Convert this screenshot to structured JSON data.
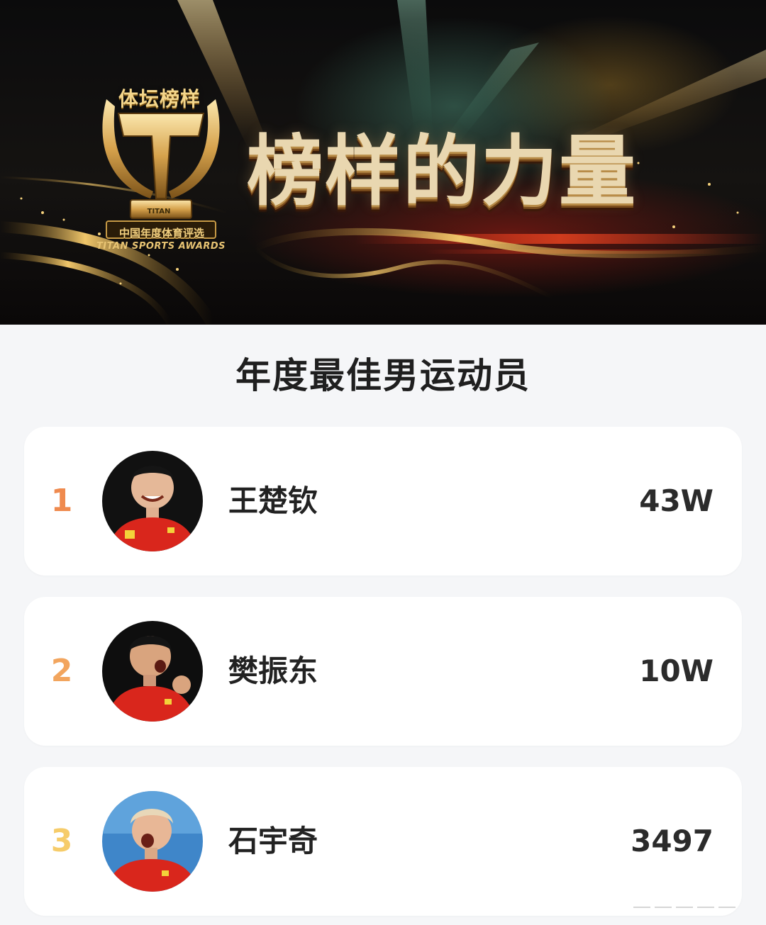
{
  "banner": {
    "logo_top_text": "体坛榜样",
    "logo_brand": "TITAN",
    "logo_cn": "中国年度体育评选",
    "logo_en": "TITAN SPORTS AWARDS",
    "headline": "榜样的力量"
  },
  "section": {
    "title": "年度最佳男运动员"
  },
  "ranking": [
    {
      "rank": "1",
      "name": "王楚钦",
      "votes": "43W",
      "rank_color": "#ef8a4e"
    },
    {
      "rank": "2",
      "name": "樊振东",
      "votes": "10W",
      "rank_color": "#f2a55e"
    },
    {
      "rank": "3",
      "name": "石宇奇",
      "votes": "3497",
      "rank_color": "#f6cc6a"
    }
  ],
  "colors": {
    "page_background": "#f5f6f8",
    "card_background": "#ffffff",
    "jersey_red": "#d9261c",
    "gold": "#e9c06a"
  }
}
